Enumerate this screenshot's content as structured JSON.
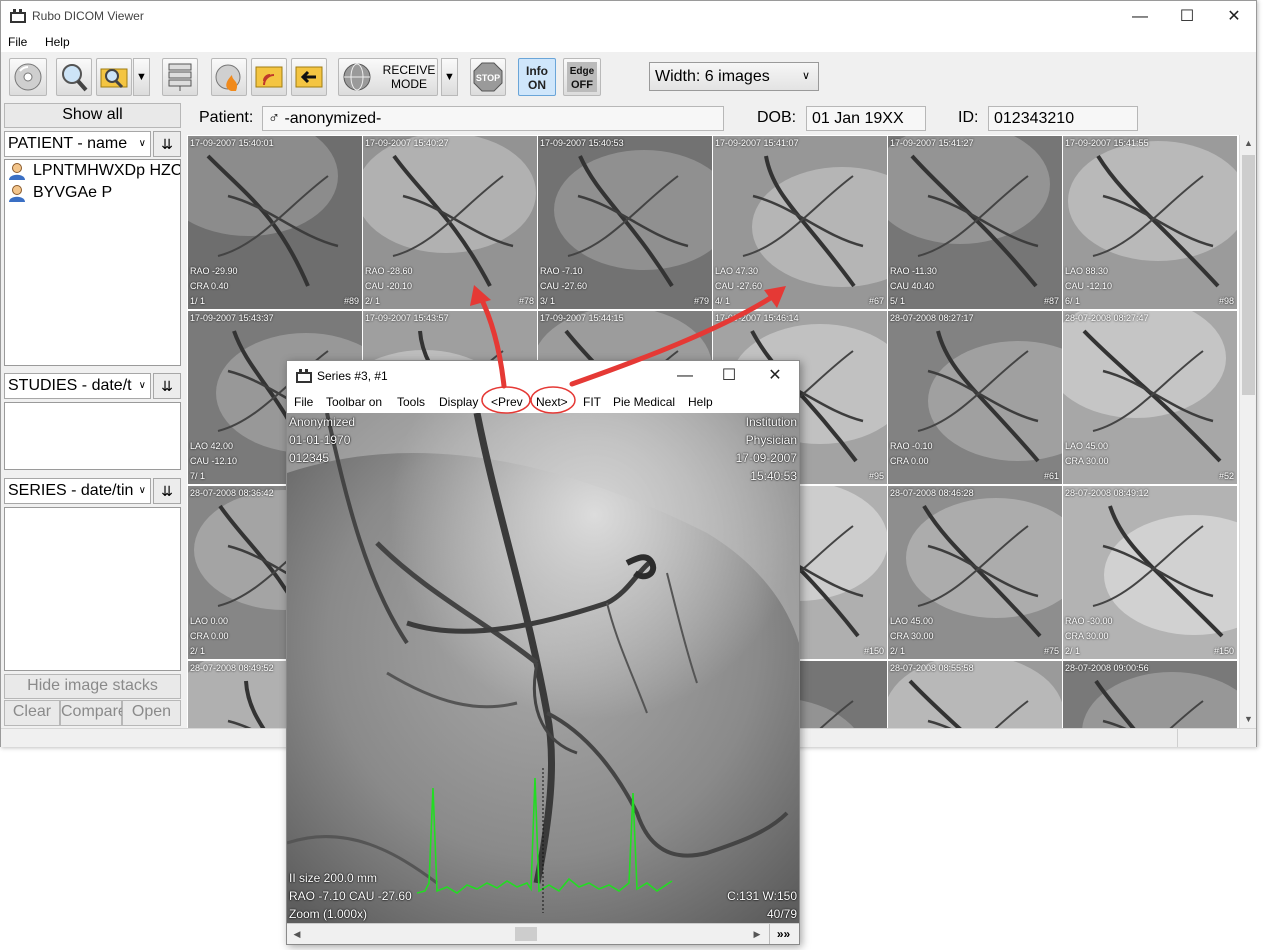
{
  "app": {
    "title": "Rubo DICOM Viewer"
  },
  "menubar": {
    "file": "File",
    "help": "Help"
  },
  "toolbar": {
    "receive_line1": "RECEIVE",
    "receive_line2": "MODE",
    "stop": "STOP",
    "info_line1": "Info",
    "info_line2": "ON",
    "edge_line1": "Edge",
    "edge_line2": "OFF",
    "width_select": "Width: 6 images"
  },
  "left_panel": {
    "show_all": "Show all",
    "patient_header": "PATIENT - name",
    "patients": [
      "LPNTMHWXDp HZC",
      "BYVGAe P"
    ],
    "studies_header": "STUDIES - date/t",
    "series_header": "SERIES - date/tin",
    "hide_stacks": "Hide image stacks",
    "clear": "Clear",
    "compare": "Compare",
    "open": "Open"
  },
  "patient_bar": {
    "patient_label": "Patient:",
    "gender_icon": "♂",
    "patient_value": "-anonymized-",
    "dob_label": "DOB:",
    "dob_value": "01 Jan 19XX",
    "id_label": "ID:",
    "id_value": "012343210"
  },
  "thumbnails": [
    {
      "ts": "17-09-2007  15:40:01",
      "a1": "RAO -29.90",
      "a2": "CRA 0.40",
      "idx": "1/ 1",
      "num": "#89"
    },
    {
      "ts": "17-09-2007  15:40:27",
      "a1": "RAO -28.60",
      "a2": "CAU -20.10",
      "idx": "2/ 1",
      "num": "#78"
    },
    {
      "ts": "17-09-2007  15:40:53",
      "a1": "RAO -7.10",
      "a2": "CAU -27.60",
      "idx": "3/ 1",
      "num": "#79"
    },
    {
      "ts": "17-09-2007  15:41:07",
      "a1": "LAO 47.30",
      "a2": "CAU -27.60",
      "idx": "4/ 1",
      "num": "#67"
    },
    {
      "ts": "17-09-2007  15:41:27",
      "a1": "RAO -11.30",
      "a2": "CAU 40.40",
      "idx": "5/ 1",
      "num": "#87"
    },
    {
      "ts": "17-09-2007  15:41:55",
      "a1": "LAO 88.30",
      "a2": "CAU -12.10",
      "idx": "6/ 1",
      "num": "#98"
    },
    {
      "ts": "17-09-2007  15:43:37",
      "a1": "LAO 42.00",
      "a2": "CAU -12.10",
      "idx": "7/ 1",
      "num": ""
    },
    {
      "ts": "17-09-2007  15:43:57",
      "a1": "",
      "a2": "",
      "idx": "",
      "num": ""
    },
    {
      "ts": "17-09-2007  15:44:15",
      "a1": "",
      "a2": "",
      "idx": "",
      "num": ""
    },
    {
      "ts": "17-09-2007  15:46:14",
      "a1": "",
      "a2": "",
      "idx": "",
      "num": "#95"
    },
    {
      "ts": "28-07-2008  08:27:17",
      "a1": "RAO -0.10",
      "a2": "CRA 0.00",
      "idx": "",
      "num": "#61"
    },
    {
      "ts": "28-07-2008  08:27:47",
      "a1": "LAO 45.00",
      "a2": "CRA 30.00",
      "idx": "",
      "num": "#52"
    },
    {
      "ts": "28-07-2008  08:36:42",
      "a1": "LAO 0.00",
      "a2": "CRA 0.00",
      "idx": "2/ 1",
      "num": ""
    },
    {
      "ts": "",
      "a1": "",
      "a2": "",
      "idx": "",
      "num": ""
    },
    {
      "ts": "",
      "a1": "",
      "a2": "",
      "idx": "",
      "num": ""
    },
    {
      "ts": "",
      "a1": "",
      "a2": "",
      "idx": "",
      "num": "#150"
    },
    {
      "ts": "28-07-2008  08:46:28",
      "a1": "LAO 45.00",
      "a2": "CRA 30.00",
      "idx": "2/ 1",
      "num": "#75"
    },
    {
      "ts": "28-07-2008  08:49:12",
      "a1": "RAO -30.00",
      "a2": "CRA 30.00",
      "idx": "2/ 1",
      "num": "#150"
    },
    {
      "ts": "28-07-2008  08:49:52",
      "a1": "",
      "a2": "",
      "idx": "",
      "num": ""
    },
    {
      "ts": "",
      "a1": "",
      "a2": "",
      "idx": "",
      "num": ""
    },
    {
      "ts": "",
      "a1": "",
      "a2": "",
      "idx": "",
      "num": ""
    },
    {
      "ts": "",
      "a1": "",
      "a2": "",
      "idx": "",
      "num": ""
    },
    {
      "ts": "28-07-2008  08:55:58",
      "a1": "",
      "a2": "",
      "idx": "",
      "num": ""
    },
    {
      "ts": "28-07-2008  09:00:56",
      "a1": "",
      "a2": "",
      "idx": "",
      "num": ""
    }
  ],
  "series_window": {
    "title": "Series #3, #1",
    "menu": [
      "File",
      "Toolbar on",
      "Tools",
      "Display",
      "<Prev",
      "Next>",
      "FIT",
      "Pie Medical",
      "Help"
    ],
    "overlay": {
      "top_left": [
        "Anonymized",
        "01-01-1970",
        "012345"
      ],
      "top_right": [
        "Institution",
        "Physician",
        "17-09-2007",
        "15:40:53"
      ],
      "bottom_left": [
        "II size 200.0 mm",
        "RAO -7.10  CAU -27.60",
        "Zoom (1.000x)"
      ],
      "bottom_right": [
        "C:131 W:150",
        "40/79"
      ]
    },
    "fast_forward": "»»"
  },
  "colors": {
    "accent_selected": "#e07a2a",
    "annotation": "#e53935",
    "ecg": "#22dd22"
  }
}
